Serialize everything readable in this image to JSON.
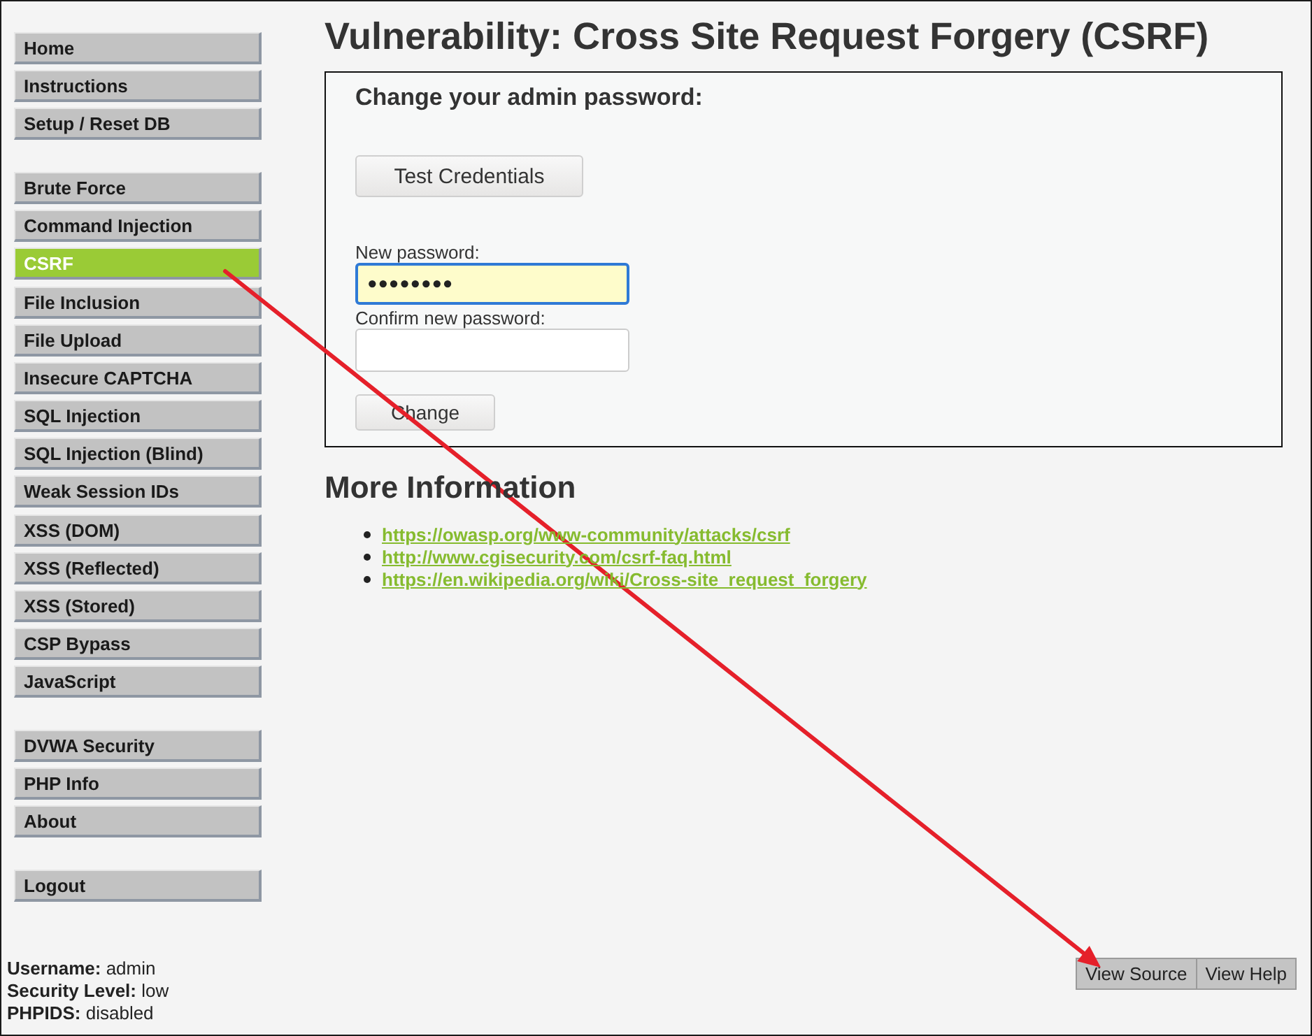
{
  "sidebar": {
    "groups": [
      {
        "items": [
          {
            "label": "Home",
            "selected": false
          },
          {
            "label": "Instructions",
            "selected": false
          },
          {
            "label": "Setup / Reset DB",
            "selected": false
          }
        ]
      },
      {
        "items": [
          {
            "label": "Brute Force",
            "selected": false
          },
          {
            "label": "Command Injection",
            "selected": false
          },
          {
            "label": "CSRF",
            "selected": true
          },
          {
            "label": "File Inclusion",
            "selected": false
          },
          {
            "label": "File Upload",
            "selected": false
          },
          {
            "label": "Insecure CAPTCHA",
            "selected": false
          },
          {
            "label": "SQL Injection",
            "selected": false
          },
          {
            "label": "SQL Injection (Blind)",
            "selected": false
          },
          {
            "label": "Weak Session IDs",
            "selected": false
          },
          {
            "label": "XSS (DOM)",
            "selected": false
          },
          {
            "label": "XSS (Reflected)",
            "selected": false
          },
          {
            "label": "XSS (Stored)",
            "selected": false
          },
          {
            "label": "CSP Bypass",
            "selected": false
          },
          {
            "label": "JavaScript",
            "selected": false
          }
        ]
      },
      {
        "items": [
          {
            "label": "DVWA Security",
            "selected": false
          },
          {
            "label": "PHP Info",
            "selected": false
          },
          {
            "label": "About",
            "selected": false
          }
        ]
      },
      {
        "items": [
          {
            "label": "Logout",
            "selected": false
          }
        ]
      }
    ]
  },
  "main": {
    "title": "Vulnerability: Cross Site Request Forgery (CSRF)",
    "form": {
      "heading": "Change your admin password:",
      "test_button": "Test Credentials",
      "fields": [
        {
          "label": "New password:",
          "value": "••••••••",
          "focused": true
        },
        {
          "label": "Confirm new password:",
          "focused": false
        }
      ],
      "submit_button": "Change"
    },
    "more_info": {
      "heading": "More Information",
      "links": [
        "https://owasp.org/www-community/attacks/csrf",
        "http://www.cgisecurity.com/csrf-faq.html",
        "https://en.wikipedia.org/wiki/Cross-site_request_forgery"
      ]
    }
  },
  "footer": {
    "info": [
      {
        "label": "Username:",
        "value": "admin"
      },
      {
        "label": "Security Level:",
        "value": "low"
      },
      {
        "label": "PHPIDS:",
        "value": "disabled"
      }
    ],
    "buttons": [
      "View Source",
      "View Help"
    ]
  }
}
